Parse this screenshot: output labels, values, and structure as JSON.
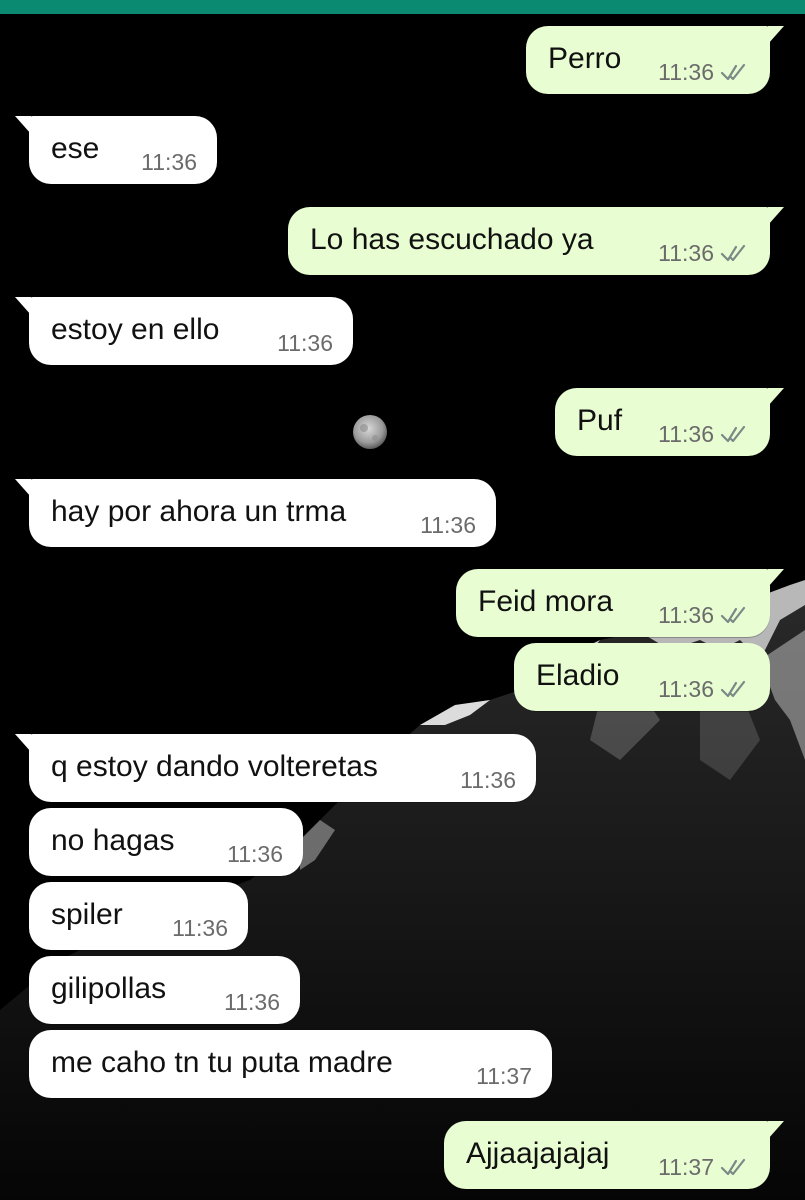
{
  "theme": {
    "header_color": "#0b8a72",
    "incoming_bubble": "#ffffff",
    "outgoing_bubble": "#e8fdd2",
    "time_color": "#6b6b6b",
    "read_check_color": "#7a8a86"
  },
  "messages": [
    {
      "direction": "out",
      "text": "Perro",
      "time": "11:36",
      "status": "read"
    },
    {
      "direction": "in",
      "text": "ese",
      "time": "11:36"
    },
    {
      "direction": "out",
      "text": "Lo has escuchado ya",
      "time": "11:36",
      "status": "read"
    },
    {
      "direction": "in",
      "text": "estoy en ello",
      "time": "11:36"
    },
    {
      "direction": "out",
      "text": "Puf",
      "time": "11:36",
      "status": "read"
    },
    {
      "direction": "in",
      "text": "hay por ahora un trma",
      "time": "11:36"
    },
    {
      "direction": "out",
      "text": "Feid mora",
      "time": "11:36",
      "status": "read"
    },
    {
      "direction": "out",
      "text": "Eladio",
      "time": "11:36",
      "status": "read"
    },
    {
      "direction": "in",
      "text": "q estoy dando volteretas",
      "time": "11:36"
    },
    {
      "direction": "in",
      "text": "no hagas",
      "time": "11:36"
    },
    {
      "direction": "in",
      "text": "spiler",
      "time": "11:36"
    },
    {
      "direction": "in",
      "text": "gilipollas",
      "time": "11:36"
    },
    {
      "direction": "in",
      "text": "me caho tn tu puta madre",
      "time": "11:37"
    },
    {
      "direction": "out",
      "text": "Ajjaajajajaj",
      "time": "11:37",
      "status": "read"
    }
  ]
}
